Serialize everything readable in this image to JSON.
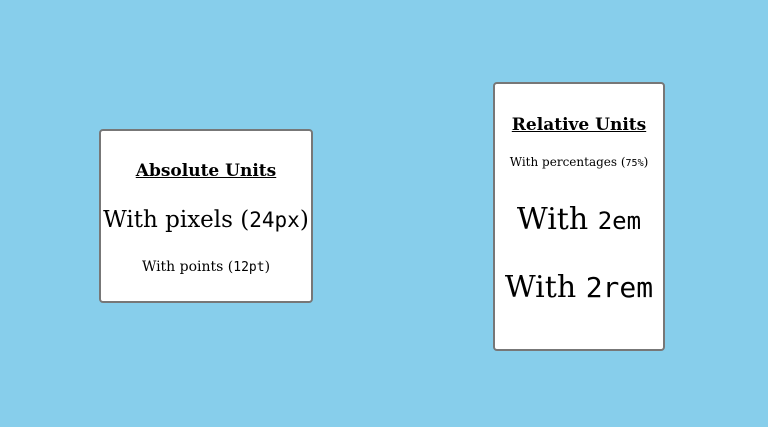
{
  "absolute_card": {
    "title": "Absolute Units",
    "pixels": {
      "prefix": "With pixels (",
      "code": "24px",
      "suffix": ")"
    },
    "points": {
      "prefix": "With points (",
      "code": "12pt",
      "suffix": ")"
    }
  },
  "relative_card": {
    "title": "Relative Units",
    "percentages": {
      "prefix": "With percentages (",
      "code": "75%",
      "suffix": ")"
    },
    "em": {
      "prefix": "With ",
      "code": "2em"
    },
    "rem": {
      "prefix": "With ",
      "code": "2rem"
    }
  },
  "colors": {
    "background": "#87ceeb",
    "card": "#ffffff",
    "card_border": "#777777"
  }
}
